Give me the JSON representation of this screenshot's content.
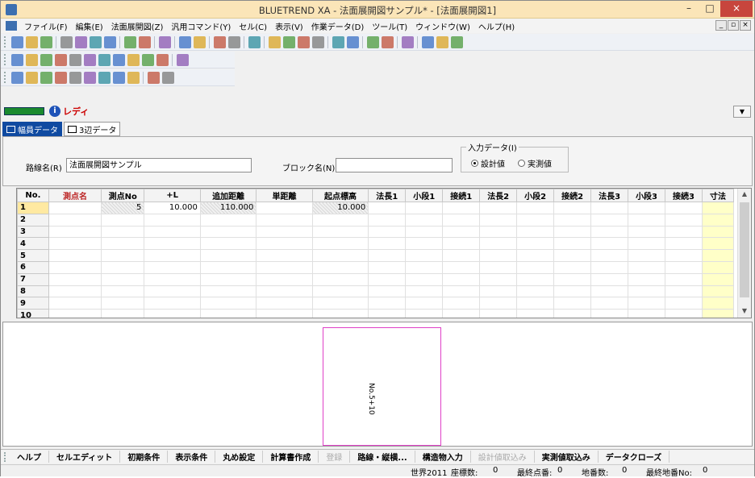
{
  "window": {
    "title": "BLUETREND XA - 法面展開図サンプル* - [法面展開図1]",
    "minimize": "–",
    "maximize": "□",
    "close": "×"
  },
  "menubar": {
    "items": [
      "ファイル(F)",
      "編集(E)",
      "法面展開図(Z)",
      "汎用コマンド(Y)",
      "セル(C)",
      "表示(V)",
      "作業データ(D)",
      "ツール(T)",
      "ウィンドウ(W)",
      "ヘルプ(H)"
    ],
    "mdi_controls": [
      "_",
      "▫",
      "×"
    ]
  },
  "status": {
    "ready_text": "レディ",
    "progress": 1.0,
    "progress_color": "#1a8a2e"
  },
  "tabs": [
    {
      "label": "幅員データ",
      "active": true
    },
    {
      "label": "3辺データ",
      "active": false
    }
  ],
  "form": {
    "route_label": "路線名(R)",
    "route_value": "法面展開図サンプル",
    "block_label": "ブロック名(N)",
    "block_value": "",
    "input_group_label": "入力データ(I)",
    "radio_design": "設計値",
    "radio_actual": "実測値",
    "radio_selected": "設計値"
  },
  "grid": {
    "columns": [
      "No.",
      "測点名",
      "測点No",
      "+L",
      "追加距離",
      "単距離",
      "起点標高",
      "法長1",
      "小段1",
      "接続1",
      "法長2",
      "小段2",
      "接続2",
      "法長3",
      "小段3",
      "接続3",
      "寸法"
    ],
    "rows": [
      [
        "1",
        "",
        "5",
        "10.000",
        "110.000",
        "",
        "10.000",
        "",
        "",
        "",
        "",
        "",
        "",
        "",
        "",
        "",
        ""
      ],
      [
        "2",
        "",
        "",
        "",
        "",
        "",
        "",
        "",
        "",
        "",
        "",
        "",
        "",
        "",
        "",
        "",
        ""
      ],
      [
        "3",
        "",
        "",
        "",
        "",
        "",
        "",
        "",
        "",
        "",
        "",
        "",
        "",
        "",
        "",
        "",
        ""
      ],
      [
        "4",
        "",
        "",
        "",
        "",
        "",
        "",
        "",
        "",
        "",
        "",
        "",
        "",
        "",
        "",
        "",
        ""
      ],
      [
        "5",
        "",
        "",
        "",
        "",
        "",
        "",
        "",
        "",
        "",
        "",
        "",
        "",
        "",
        "",
        "",
        ""
      ],
      [
        "6",
        "",
        "",
        "",
        "",
        "",
        "",
        "",
        "",
        "",
        "",
        "",
        "",
        "",
        "",
        "",
        ""
      ],
      [
        "7",
        "",
        "",
        "",
        "",
        "",
        "",
        "",
        "",
        "",
        "",
        "",
        "",
        "",
        "",
        "",
        ""
      ],
      [
        "8",
        "",
        "",
        "",
        "",
        "",
        "",
        "",
        "",
        "",
        "",
        "",
        "",
        "",
        "",
        "",
        ""
      ],
      [
        "9",
        "",
        "",
        "",
        "",
        "",
        "",
        "",
        "",
        "",
        "",
        "",
        "",
        "",
        "",
        "",
        ""
      ],
      [
        "10",
        "",
        "",
        "",
        "",
        "",
        "",
        "",
        "",
        "",
        "",
        "",
        "",
        "",
        "",
        "",
        ""
      ]
    ]
  },
  "drawing": {
    "station_label": "No.5+10",
    "box_color": "#e040c8"
  },
  "function_keys": [
    {
      "label": "ヘルプ",
      "enabled": true
    },
    {
      "label": "セルエディット",
      "enabled": true
    },
    {
      "label": "初期条件",
      "enabled": true
    },
    {
      "label": "表示条件",
      "enabled": true
    },
    {
      "label": "丸め設定",
      "enabled": true
    },
    {
      "label": "計算書作成",
      "enabled": true
    },
    {
      "label": "登録",
      "enabled": false
    },
    {
      "label": "路線・縦横...",
      "enabled": true
    },
    {
      "label": "構造物入力",
      "enabled": true
    },
    {
      "label": "設計値取込み",
      "enabled": false
    },
    {
      "label": "実測値取込み",
      "enabled": true
    },
    {
      "label": "データクローズ",
      "enabled": true
    }
  ],
  "statusbar": {
    "system": "世界2011",
    "coords_label": "座標数:",
    "coords_value": "0",
    "last_point_label": "最終点番:",
    "last_point_value": "0",
    "lot_count_label": "地番数:",
    "lot_count_value": "0",
    "last_lot_label": "最終地番No:",
    "last_lot_value": "0"
  },
  "toolbar_icons": {
    "row1": [
      "new-icon",
      "open-icon",
      "save-icon",
      "sep",
      "print-preview-icon",
      "copy-icon",
      "print-icon",
      "paste-icon",
      "sep",
      "cut-icon",
      "undo-icon",
      "sep",
      "help-icon",
      "sep",
      "chart-icon",
      "layers-icon",
      "sep",
      "zoom-icon",
      "settings-icon",
      "sep",
      "arrow-icon",
      "sep",
      "import-icon",
      "export-icon",
      "list-icon",
      "binoculars-icon",
      "sep",
      "table-icon",
      "grid-icon",
      "sep",
      "node-icon",
      "check-icon",
      "sep",
      "target-icon",
      "sep",
      "align-icon",
      "align-icon",
      "align-icon"
    ],
    "row2": [
      "zoom-in-icon",
      "fit-icon",
      "pan-icon",
      "window-icon",
      "camera-icon",
      "magnify-icon",
      "pin-icon",
      "grid-icon",
      "hatch-icon",
      "undo-icon",
      "redo-icon",
      "sep",
      "marker-icon"
    ],
    "row3": [
      "calc-icon",
      "sheet-icon",
      "export-icon",
      "survey-icon",
      "cross-section-icon",
      "draw-icon",
      "edit-icon",
      "layer-icon",
      "tool-icon",
      "sep",
      "report-icon",
      "settings-icon"
    ]
  }
}
